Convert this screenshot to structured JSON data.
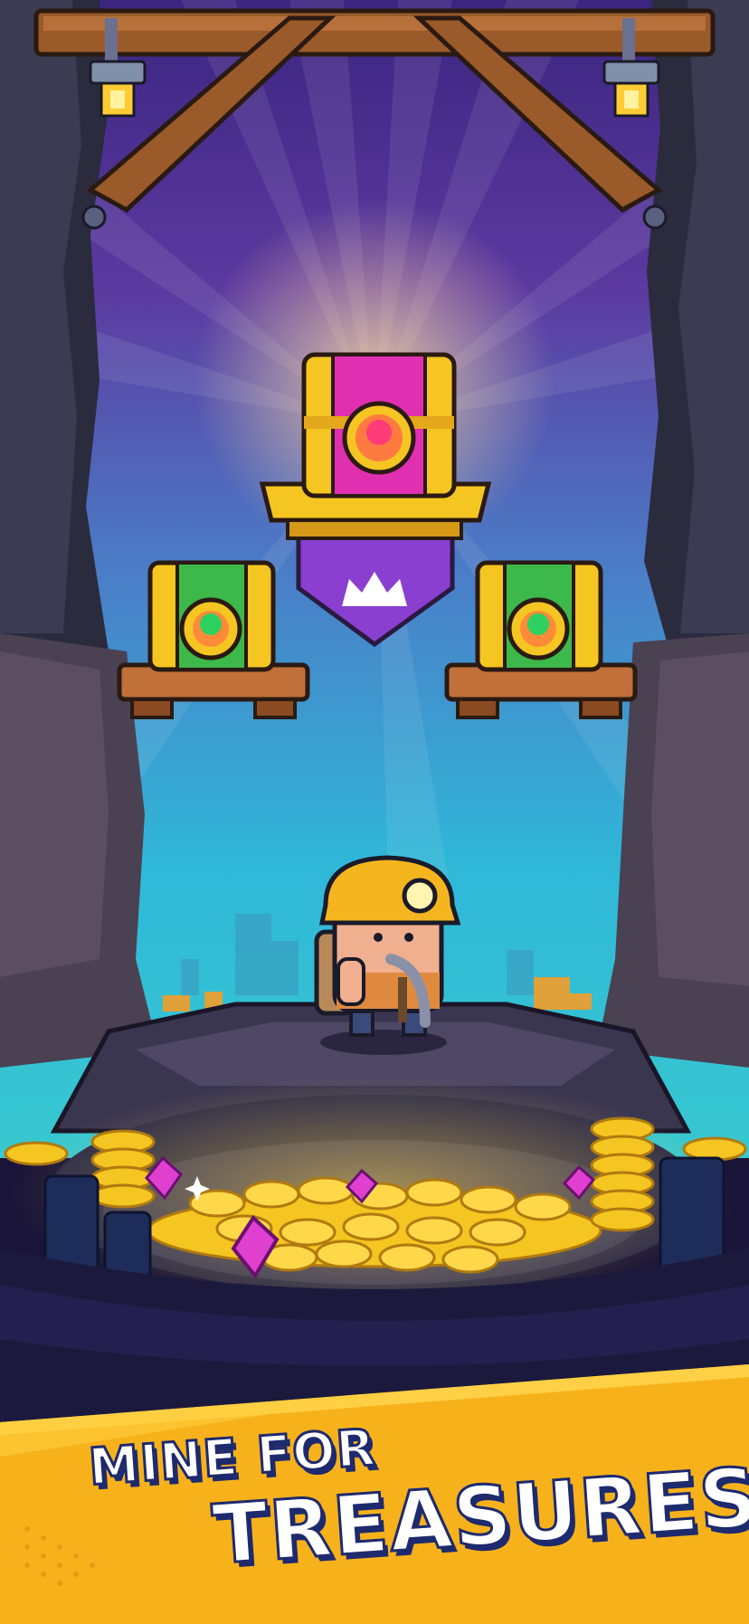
{
  "banner": {
    "line1": "MINE FOR",
    "line2": "TREASURES!"
  },
  "scene": {
    "icons": {
      "top_chest": "epic-treasure-chest-icon",
      "side_chest": "rare-treasure-chest-icon",
      "crown": "crown-icon",
      "character": "miner-character",
      "lantern": "lantern-icon",
      "gem": "pink-gem-icon",
      "coin": "gold-coin-icon",
      "pickaxe": "pickaxe-icon"
    },
    "colors": {
      "sky_top": "#4a2a8a",
      "sky_bottom": "#2fb8d8",
      "banner_yellow": "#f7b21b",
      "text_outline": "#1e2a6e",
      "epic_pink": "#e02fb0",
      "rare_green": "#3db84a",
      "gold": "#f5c521",
      "rock_dark": "#2f2f44"
    }
  }
}
